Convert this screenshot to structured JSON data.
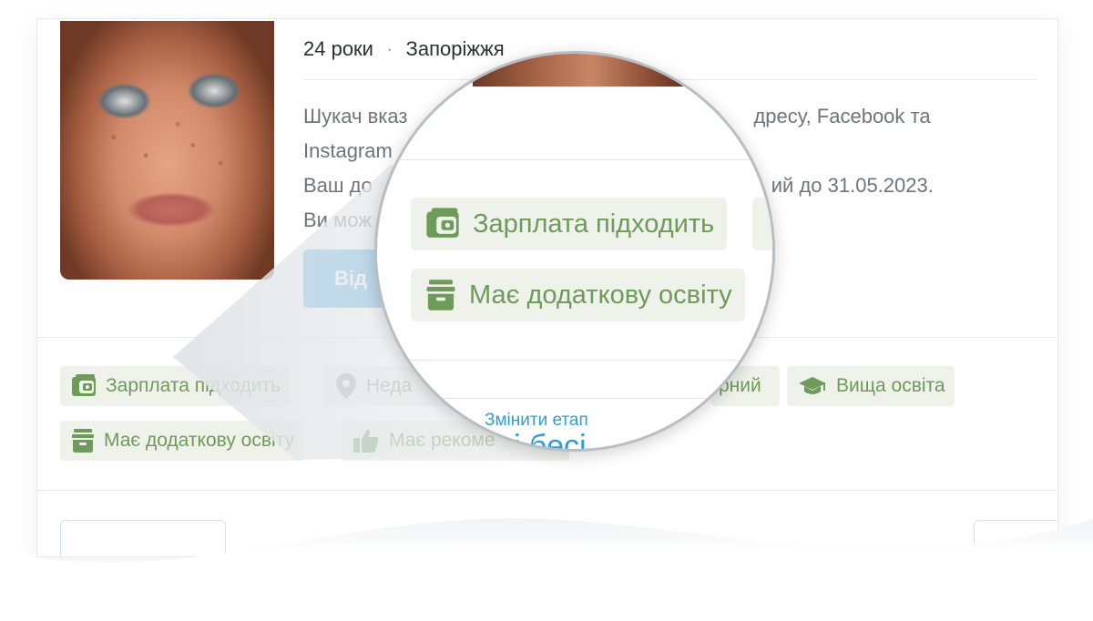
{
  "candidate": {
    "age": "24 роки",
    "separator": "·",
    "city": "Запоріжжя",
    "description_lines": [
      "Шукач вказ",
      "дресу, Facebook та",
      "Instagram",
      "Ваш до",
      "ий до 31.05.2023.",
      "Ви мож"
    ],
    "respond_button_label": "Від"
  },
  "tags": [
    {
      "icon": "wallet-icon",
      "label": "Зарплата підходить"
    },
    {
      "icon": "location-pin-icon",
      "label": "Неда"
    },
    {
      "icon": "partial-tag",
      "label": "рний"
    },
    {
      "icon": "graduation-cap-icon",
      "label": "Вища освіта"
    },
    {
      "icon": "archive-box-icon",
      "label": "Має додаткову освіту"
    },
    {
      "icon": "thumbs-up-icon",
      "label": "Має рекоме"
    }
  ],
  "magnifier": {
    "tags": [
      {
        "icon": "wallet-icon",
        "label": "Зарплата підходить"
      },
      {
        "icon": "archive-box-icon",
        "label": "Має додаткову освіту"
      }
    ],
    "change_stage_link": "Змінити етап",
    "partial_text": "і бесі"
  },
  "colors": {
    "accent_blue": "#4ba9e3",
    "tag_green_text": "#6e9a5a",
    "tag_green_bg": "#eef2ea",
    "link_blue": "#2f9ed8"
  }
}
